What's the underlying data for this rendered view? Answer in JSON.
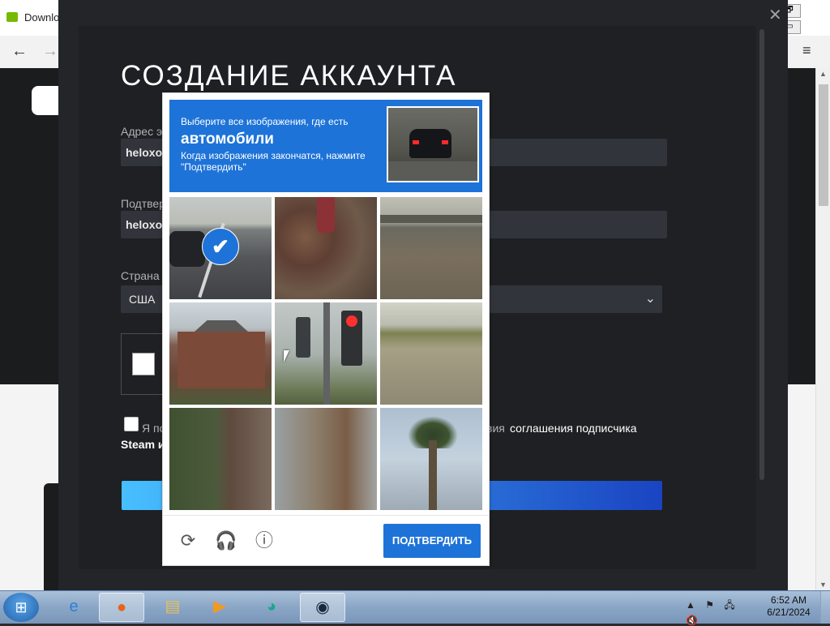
{
  "browser": {
    "tab_title": "Downlo",
    "back_icon": "←",
    "forward_icon": "→",
    "menu_icon": "≡",
    "win_restore": "🗗",
    "win_min": "▭"
  },
  "steam": {
    "close_icon": "✕",
    "title": "СОЗДАНИЕ АККАУНТА",
    "email_label": "Адрес э",
    "email_value": "heloxo9",
    "confirm_label": "Подтвер",
    "confirm_value": "heloxo9",
    "country_label": "Страна",
    "country_value": "США",
    "chevron": "⌄",
    "agree_text_start": "Я по",
    "agree_text_tail": "вия",
    "agree_link": "соглашения подписчика",
    "steam_text": "Steam и"
  },
  "captcha": {
    "prompt": "Выберите все изображения, где есть",
    "keyword": "автомобили",
    "instructions": "Когда изображения закончатся, нажмите \"Подтвердить\"",
    "tiles_selected": [
      true,
      false,
      false,
      false,
      false,
      false,
      false,
      false,
      false
    ],
    "check_icon": "✔",
    "refresh_icon": "⟳",
    "audio_icon": "🎧",
    "info_icon": "ⓘ",
    "verify_label": "ПОДТВЕРДИТЬ"
  },
  "taskbar": {
    "start_icon": "⊞",
    "apps": [
      "internet-explorer",
      "firefox",
      "file-explorer",
      "media-player",
      "app",
      "steam"
    ],
    "time": "6:52 AM",
    "date": "6/21/2024",
    "tray_up": "▲",
    "tray_flag": "⚑",
    "tray_network": "🖧",
    "tray_volume": "🔇"
  }
}
